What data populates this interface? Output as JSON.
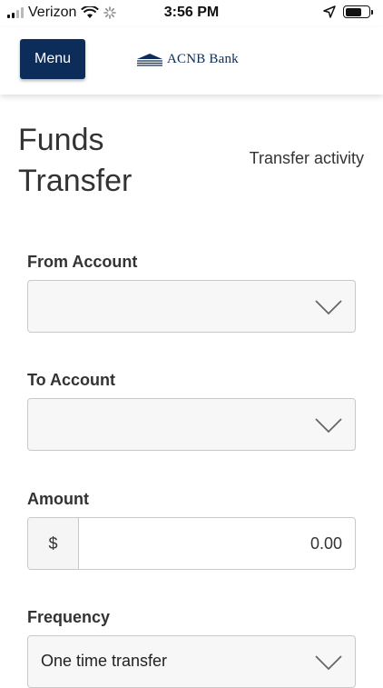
{
  "status_bar": {
    "carrier": "Verizon",
    "time": "3:56 PM"
  },
  "header": {
    "menu_label": "Menu",
    "logo_text": "ACNB Bank",
    "brand_color": "#0c2c5a"
  },
  "page": {
    "title_line1": "Funds",
    "title_line2": "Transfer",
    "activity_link": "Transfer activity"
  },
  "form": {
    "from_label": "From Account",
    "from_value": "",
    "to_label": "To Account",
    "to_value": "",
    "amount_label": "Amount",
    "currency_symbol": "$",
    "amount_value": "0.00",
    "frequency_label": "Frequency",
    "frequency_value": "One time transfer"
  }
}
